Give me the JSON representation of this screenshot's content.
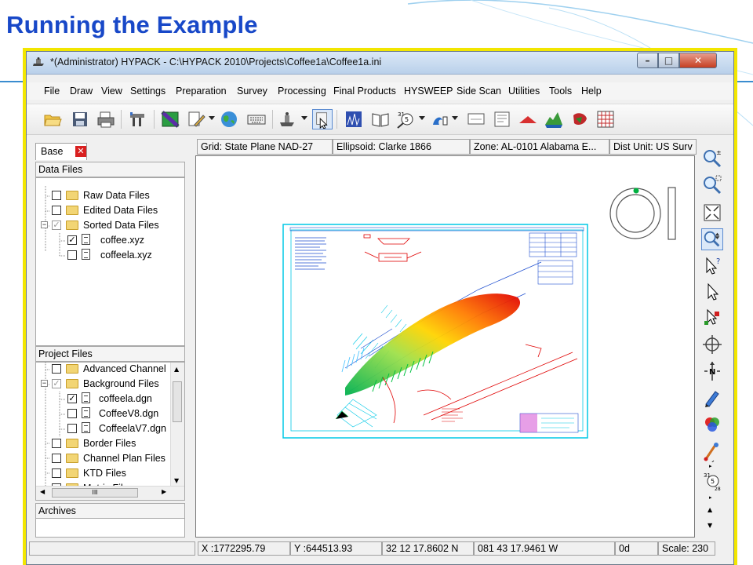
{
  "slide": {
    "title": "Running the Example"
  },
  "window": {
    "title": "*(Administrator) HYPACK - C:\\HYPACK 2010\\Projects\\Coffee1a\\Coffee1a.ini",
    "controls": {
      "minimize": "–",
      "maximize": "□",
      "close": "✕"
    }
  },
  "menu": [
    "File",
    "Draw",
    "View",
    "Settings",
    "Preparation",
    "Survey",
    "Processing",
    "Final Products",
    "HYSWEEP",
    "Side Scan",
    "Utilities",
    "Tools",
    "Help"
  ],
  "toolbar": {
    "icons": [
      "open-folder-icon",
      "save-icon",
      "print-icon",
      "hardware-icon",
      "map-icon",
      "edit-icon",
      "globe-icon",
      "keyboard-icon",
      "survey-boat-icon",
      "select-tool-icon",
      "data-display-icon",
      "book-icon",
      "calendar-tide-icon",
      "sounding-icon",
      "monitor-icon",
      "document-icon",
      "triangle-icon",
      "terrain-icon",
      "mosaic-icon",
      "grid-icon"
    ]
  },
  "left_panel": {
    "tab_label": "Base",
    "tab_close": "✕",
    "data_files": {
      "header": "Data Files",
      "items": [
        {
          "label": "Raw Data Files"
        },
        {
          "label": "Edited Data Files"
        },
        {
          "label": "Sorted Data Files",
          "checked_mark": "✓"
        },
        {
          "label": "coffee.xyz",
          "checked_mark": "✓"
        },
        {
          "label": "coffeela.xyz"
        }
      ]
    },
    "project_files": {
      "header": "Project Files",
      "items": [
        {
          "label": "Advanced Channel"
        },
        {
          "label": "Background Files",
          "checked_mark": "✓"
        },
        {
          "label": "coffeela.dgn",
          "checked_mark": "✓"
        },
        {
          "label": "CoffeeV8.dgn"
        },
        {
          "label": "CoffeelaV7.dgn"
        },
        {
          "label": "Border Files"
        },
        {
          "label": "Channel Plan Files"
        },
        {
          "label": "KTD Files"
        },
        {
          "label": "Matrix Files"
        }
      ],
      "scroll_thumb": "III"
    },
    "archives": {
      "header": "Archives"
    }
  },
  "map_status": {
    "grid": "Grid: State Plane NAD-27",
    "ellipsoid": "Ellipsoid: Clarke 1866",
    "zone": "Zone: AL-0101 Alabama E...",
    "dist_unit": "Dist Unit: US Surv"
  },
  "side_toolbar": {
    "icons": [
      "zoom-in-out-icon",
      "zoom-window-icon",
      "zoom-extents-icon",
      "zoom-pan-icon",
      "pointer-help-icon",
      "pointer-icon",
      "move-icon",
      "crosshair-icon",
      "north-arrow-icon",
      "pen-icon",
      "color-icon",
      "tide-tool-icon",
      "calendar-tool-icon"
    ],
    "north_label": "N"
  },
  "bottom_status": {
    "x": "X :1772295.79",
    "y": "Y :644513.93",
    "lat": "32 12 17.8602 N",
    "lon": "081 43 17.9461 W",
    "heading": "0d",
    "scale": "Scale: 230"
  },
  "colors": {
    "title_blue": "#1848c8",
    "frame_yellow": "#f2e600",
    "chart_cyan": "#00c8e6",
    "chart_red": "#e00000"
  }
}
